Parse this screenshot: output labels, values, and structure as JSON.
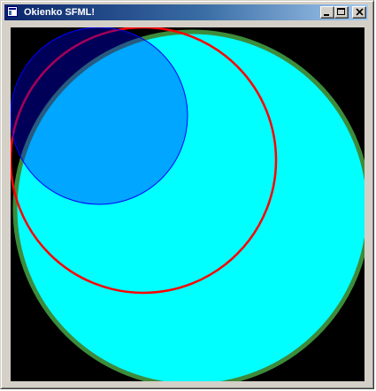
{
  "window": {
    "title": "Okienko SFML!",
    "controls": {
      "minimize": "minimize",
      "maximize": "maximize",
      "close": "close"
    }
  },
  "scene": {
    "background_color": "#000000",
    "large_circle": {
      "fill": "#00ffff",
      "outline": "#3c8c3c"
    },
    "red_ring": {
      "fill": "none",
      "outline": "#ff0000"
    },
    "blue_circle": {
      "fill": "#0000ff",
      "fill_opacity": 0.35,
      "outline": "#0000ff"
    }
  }
}
